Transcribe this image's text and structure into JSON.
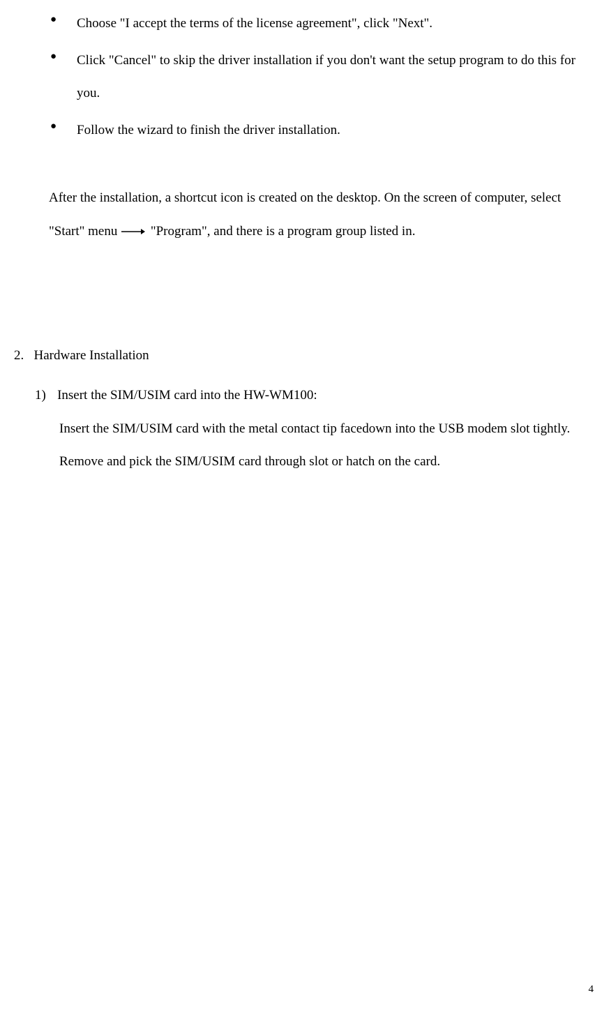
{
  "bullets": [
    "Choose \"I accept the terms of the license agreement\", click \"Next\".",
    "Click \"Cancel\" to skip the driver installation if you don't want the setup program to do this for you.",
    "Follow the wizard to finish the driver installation."
  ],
  "paragraph": {
    "part1": "After the installation, a shortcut icon is created on the desktop. On the screen of computer, select \"Start\" menu",
    "part2": "\"Program\", and there is a program group listed in."
  },
  "section": {
    "number": "2.",
    "title": "Hardware Installation"
  },
  "subitem": {
    "number": "1)",
    "title": "Insert the SIM/USIM card into the HW-WM100:",
    "body1": "Insert the SIM/USIM card with the metal contact tip facedown into the USB modem slot tightly.",
    "body2": "Remove and pick the SIM/USIM card through slot or hatch on the card."
  },
  "pageNumber": "4"
}
